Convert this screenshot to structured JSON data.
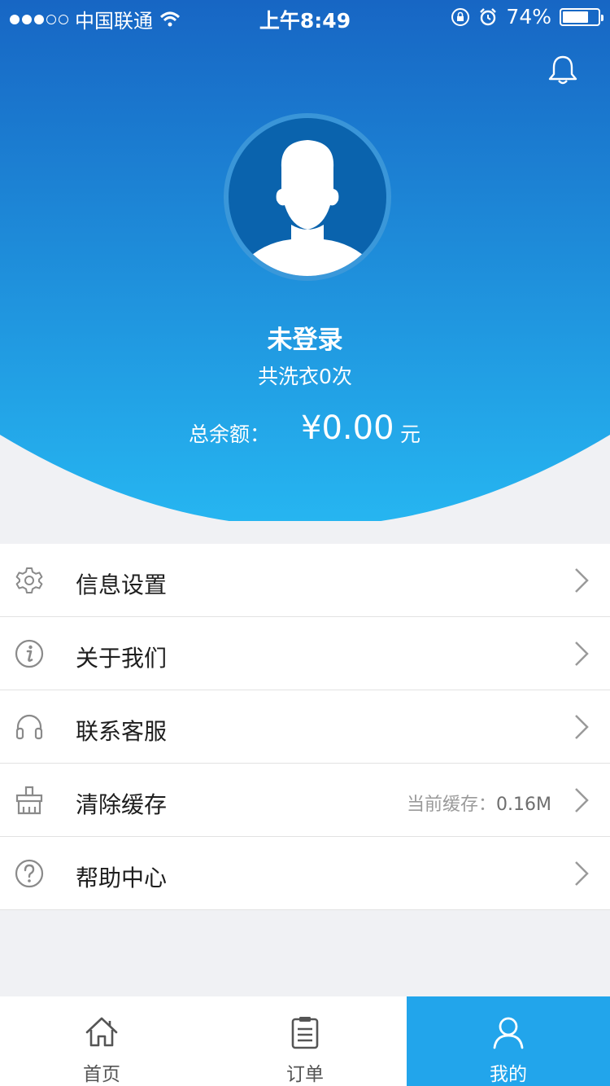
{
  "colors": {
    "header_top": "#1766c4",
    "header_bottom": "#25b3ef",
    "accent": "#22a5eb",
    "background": "#f0f1f4"
  },
  "status_bar": {
    "carrier": "中国联通",
    "time": "上午8:49",
    "battery_percent": "74%",
    "battery_level": 0.74,
    "signal_strength": 3
  },
  "profile": {
    "user_name": "未登录",
    "wash_count": "共洗衣0次",
    "balance_label": "总余额：",
    "balance_amount": "¥0.00",
    "balance_unit": "元"
  },
  "menu": [
    {
      "label": "信息设置",
      "icon": "gear-icon"
    },
    {
      "label": "关于我们",
      "icon": "info-icon"
    },
    {
      "label": "联系客服",
      "icon": "headphones-icon"
    },
    {
      "label": "清除缓存",
      "icon": "broom-icon",
      "extra_label": "当前缓存：",
      "extra_value": "0.16M"
    },
    {
      "label": "帮助中心",
      "icon": "question-icon"
    }
  ],
  "tabs": [
    {
      "label": "首页",
      "icon": "home-icon",
      "active": false
    },
    {
      "label": "订单",
      "icon": "clipboard-icon",
      "active": false
    },
    {
      "label": "我的",
      "icon": "user-icon",
      "active": true
    }
  ]
}
